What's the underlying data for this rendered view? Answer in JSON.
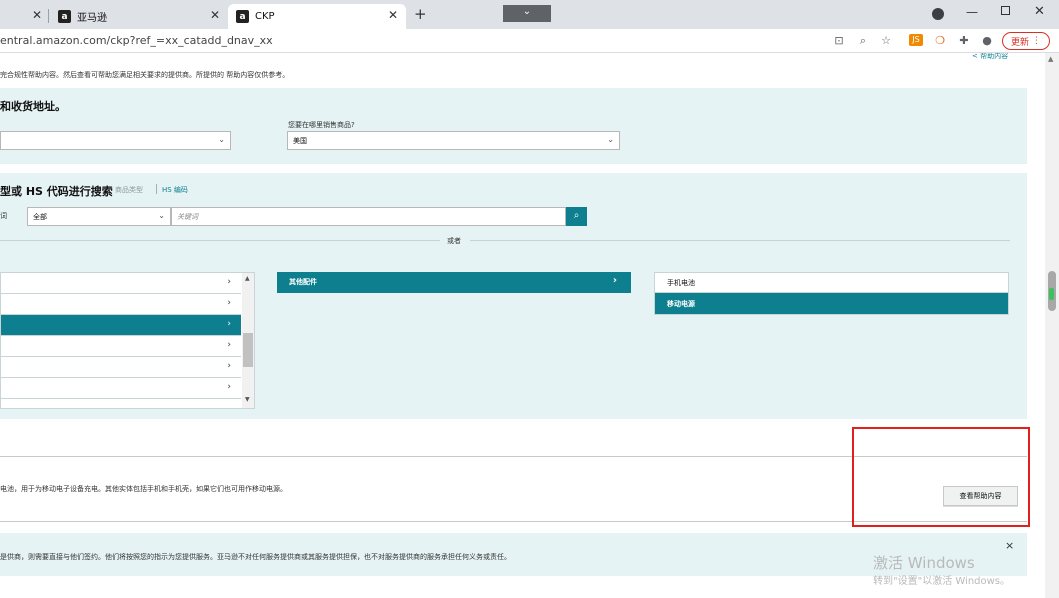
{
  "browser": {
    "tabs": [
      {
        "title": ""
      },
      {
        "title": "亚马逊",
        "favicon": "a"
      },
      {
        "title": "CKP",
        "favicon": "a"
      }
    ],
    "new_tab": "+",
    "tab_menu": "⌄",
    "url": "entral.amazon.com/ckp?ref_=xx_catadd_dnav_xx",
    "update_label": "更新"
  },
  "page": {
    "top_link": "< 帮助内容",
    "intro": "完合规性帮助内容。然后查看可帮助您满足相关要求的提供商。所提供的 帮助内容仅供参考。",
    "address_section": {
      "title": "和收货地址。",
      "sell_question": "您要在哪里销售商品?",
      "left_select": "",
      "sell_select": "美国"
    },
    "search_section": {
      "title": "型或 HS 代码进行搜索",
      "link_type": "商品类型",
      "link_hs": "HS 编码",
      "row_label": "词",
      "category_select": "全部",
      "keyword_placeholder": "关键词",
      "or_text": "或者"
    },
    "category_browser": {
      "col1_rows": [
        "",
        "",
        "",
        "",
        "",
        ""
      ],
      "col1_active_index": 2,
      "col2_items": [
        "其他配件"
      ],
      "col3_items": [
        "手机电池",
        "移动电源"
      ],
      "col3_active_index": 1
    },
    "result": {
      "description": "电池，用于为移动电子设备充电。其他实体包括手机和手机壳，如果它们也可用作移动电源。",
      "button_label": "查看帮助内容"
    },
    "disclaimer": {
      "text": "是供商，则需要直接与他们签约。他们将按照您的指示为您提供服务。亚马逊不对任何服务提供商或其服务提供担保，也不对服务提供商的服务承担任何义务或责任。",
      "close": "×"
    },
    "watermark": {
      "line1": "激活 Windows",
      "line2": "转到\"设置\"以激活 Windows。"
    }
  },
  "colors": {
    "teal": "#0d7f8e",
    "panel_bg": "#e6f3f5",
    "annotation_red": "#e0201c"
  }
}
